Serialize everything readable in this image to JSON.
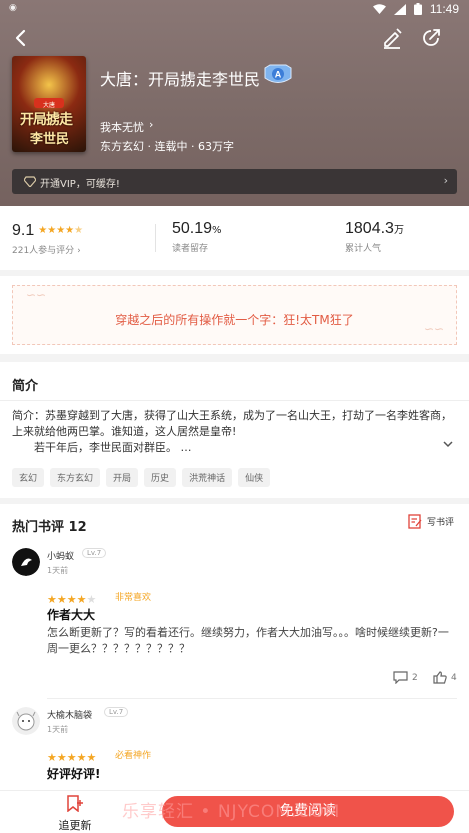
{
  "status_bar": {
    "time": "11:49"
  },
  "book": {
    "title": "大唐：开局掳走李世民",
    "author": "我本无忧",
    "meta": "东方玄幻 · 连载中 · 63万字",
    "cover_text": {
      "tag": "大唐",
      "line1": "开局掳走",
      "line2": "李世民"
    }
  },
  "vip_bar": {
    "text": "开通VIP，可缓存!"
  },
  "stats": {
    "rating": "9.1",
    "rating_sub": "221人参与评分",
    "rating_stars": 4.5,
    "retention": "50.19",
    "retention_unit": "%",
    "retention_sub": "读者留存",
    "popularity": "1804.3",
    "popularity_unit": "万",
    "popularity_sub": "累计人气"
  },
  "quote": {
    "text": "穿越之后的所有操作就一个字：狂!太TM狂了"
  },
  "intro": {
    "title": "简介",
    "body_line1": "简介：苏墨穿越到了大唐，获得了山大王系统，成为了一名山大王，打劫了一名李姓客商，上来就给他两巴掌。谁知道，这人居然是皇帝!",
    "body_line2": "若干年后，李世民面对群臣。 …",
    "tags": [
      "玄幻",
      "东方玄幻",
      "开局",
      "历史",
      "洪荒神话",
      "仙侠"
    ]
  },
  "reviews": {
    "header": "热门书评 12",
    "write_label": "写书评",
    "items": [
      {
        "user": "小蚂蚁",
        "level": "Lv.7",
        "time": "1天前",
        "stars": 4,
        "rating_label": "非常喜欢",
        "title": "作者大大",
        "body": "怎么断更新了？写的看着还行。继续努力，作者大大加油写。。。啥时候继续更新?一周一更么？？？？？？？？？",
        "comments": "2",
        "likes": "4"
      },
      {
        "user": "大榆木脑袋",
        "level": "Lv.7",
        "time": "1天前",
        "stars": 5,
        "rating_label": "必看神作",
        "title": "好评好评!",
        "body": ""
      }
    ]
  },
  "bottom_bar": {
    "update_label": "追更新",
    "read_label": "免费阅读"
  },
  "watermark": "乐享轻汇 • NJYCOM.COM",
  "colors": {
    "accent": "#f0534a",
    "star": "#f4a623",
    "quote": "#e25b43"
  }
}
